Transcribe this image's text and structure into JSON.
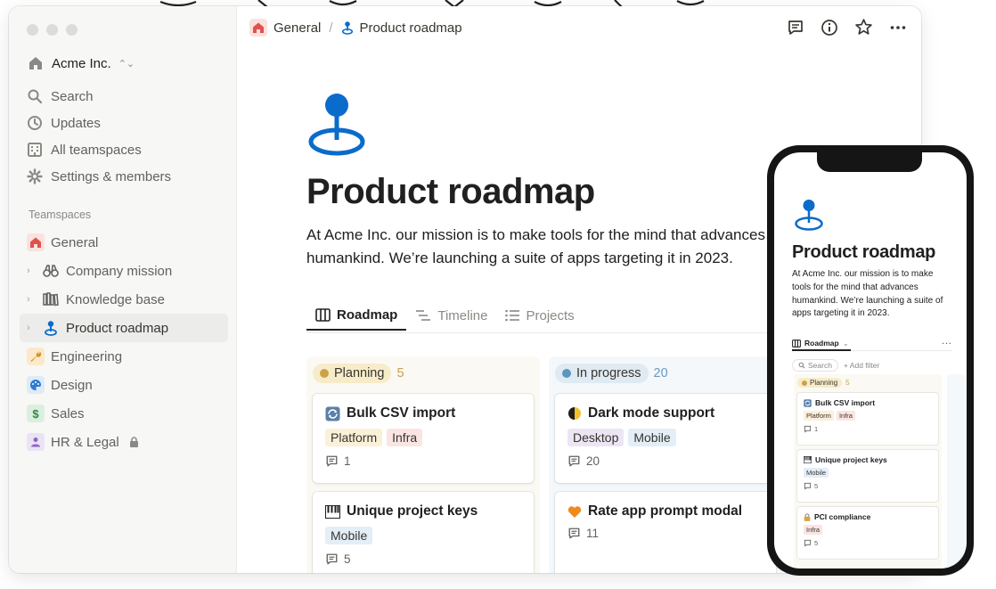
{
  "colors": {
    "accent_blue": "#0b6bcb",
    "planning_dot": "#cba24a",
    "progress_dot": "#5b97bd"
  },
  "workspace": {
    "name": "Acme Inc."
  },
  "nav": [
    {
      "label": "Search",
      "icon": "search-icon"
    },
    {
      "label": "Updates",
      "icon": "clock-icon"
    },
    {
      "label": "All teamspaces",
      "icon": "building-icon"
    },
    {
      "label": "Settings & members",
      "icon": "gear-icon"
    }
  ],
  "teamspaces_label": "Teamspaces",
  "teamspaces": [
    {
      "label": "General",
      "icon": "home-icon"
    },
    {
      "label": "Company mission",
      "icon": "binoculars-icon"
    },
    {
      "label": "Knowledge base",
      "icon": "books-icon"
    },
    {
      "label": "Product roadmap",
      "icon": "pin-icon"
    },
    {
      "label": "Engineering",
      "icon": "wrench-icon"
    },
    {
      "label": "Design",
      "icon": "palette-icon"
    },
    {
      "label": "Sales",
      "icon": "dollar-icon"
    },
    {
      "label": "HR & Legal",
      "icon": "person-icon"
    }
  ],
  "breadcrumb": {
    "parent": "General",
    "current": "Product roadmap"
  },
  "page": {
    "title": "Product roadmap",
    "description_line1": "At Acme Inc. our mission is to make tools for the mind that advances",
    "description_line2": "humankind. We’re launching a suite of apps targeting it in 2023."
  },
  "tabs": [
    {
      "label": "Roadmap"
    },
    {
      "label": "Timeline"
    },
    {
      "label": "Projects"
    }
  ],
  "board": {
    "columns": [
      {
        "name": "Planning",
        "count": "5",
        "cards": [
          {
            "title": "Bulk CSV import",
            "icon": "refresh-icon",
            "tags": [
              "Platform",
              "Infra"
            ],
            "comments": "1"
          },
          {
            "title": "Unique project keys",
            "icon": "piano-icon",
            "tags": [
              "Mobile"
            ],
            "comments": "5"
          }
        ]
      },
      {
        "name": "In progress",
        "count": "20",
        "cards": [
          {
            "title": "Dark mode support",
            "icon": "half-moon-icon",
            "tags": [
              "Desktop",
              "Mobile"
            ],
            "comments": "20"
          },
          {
            "title": "Rate app prompt modal",
            "icon": "heart-icon",
            "tags": [],
            "comments": "11"
          }
        ]
      }
    ]
  },
  "mobile": {
    "title": "Product roadmap",
    "description": "At Acme Inc. our mission is to make tools for the mind that advances humankind. We’re launching a suite of apps targeting it in 2023.",
    "tab": "Roadmap",
    "search_placeholder": "Search",
    "add_filter": "+ Add filter",
    "column": {
      "name": "Planning",
      "count": "5"
    },
    "cards": [
      {
        "title": "Bulk CSV import",
        "tags": [
          "Platform",
          "Infra"
        ],
        "comments": "1"
      },
      {
        "title": "Unique project keys",
        "tags": [
          "Mobile"
        ],
        "comments": "5"
      },
      {
        "title": "PCI compliance",
        "tags": [
          "Infra"
        ],
        "comments": "5"
      }
    ]
  }
}
